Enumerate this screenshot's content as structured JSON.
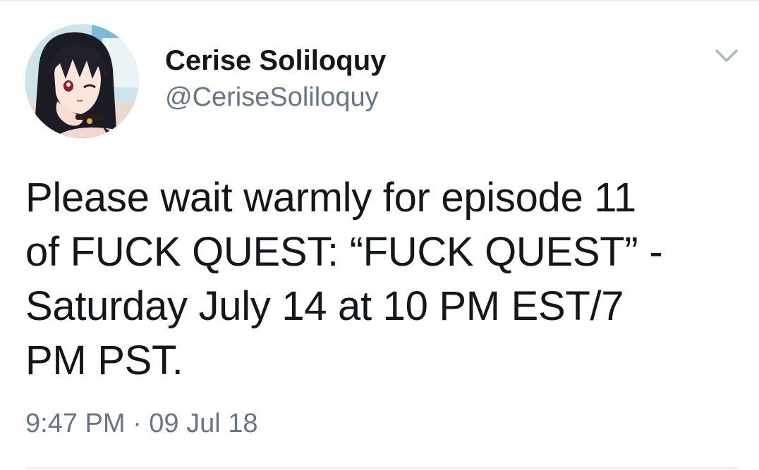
{
  "tweet": {
    "author": {
      "display_name": "Cerise Soliloquy",
      "handle": "@CeriseSoliloquy",
      "avatar_icon": "anime-avatar-icon"
    },
    "menu_icon": "chevron-down-icon",
    "text": "Please wait warmly for episode 11\nof FUCK QUEST: “FUCK QUEST” -\nSaturday July 14 at 10 PM EST/7\nPM PST.",
    "timestamp": "9:47 PM · 09 Jul 18"
  },
  "colors": {
    "text_primary": "#14171a",
    "text_secondary": "#657786",
    "divider": "#e6ecf0",
    "chevron": "#aab8c2"
  }
}
